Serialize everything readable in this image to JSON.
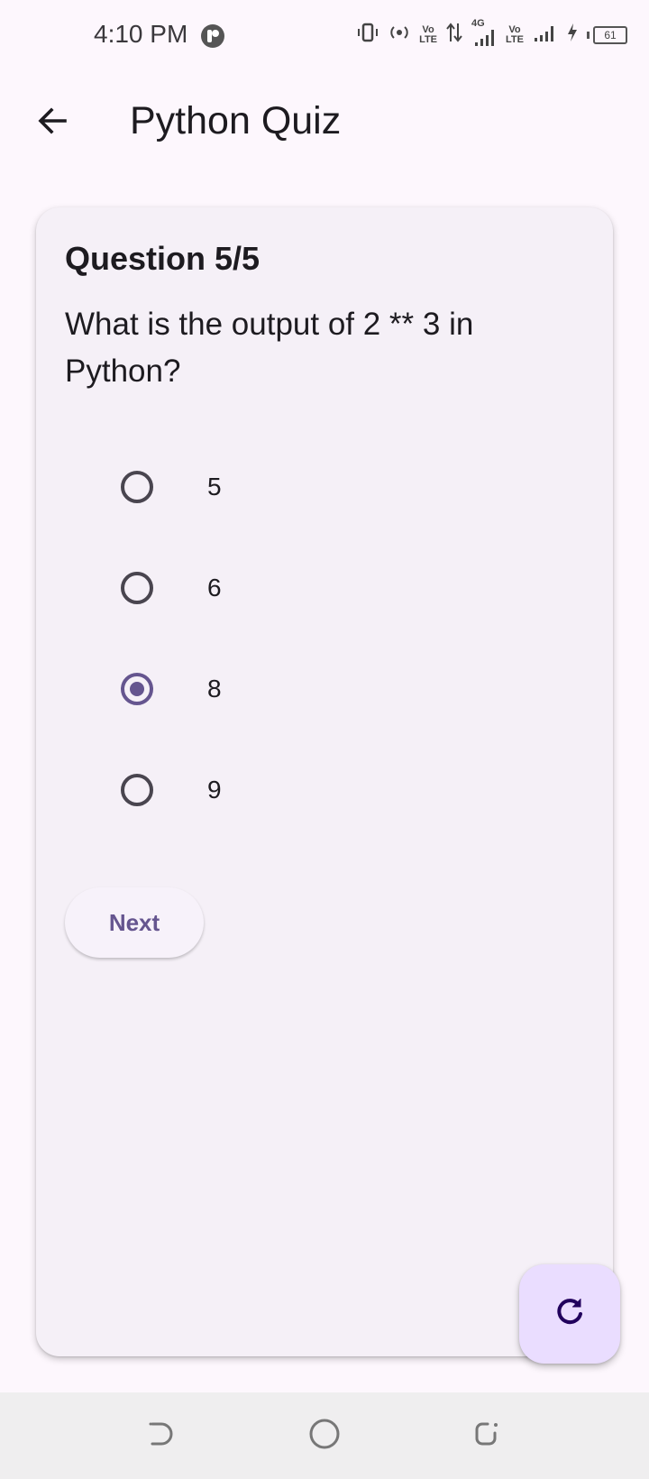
{
  "status_bar": {
    "time": "4:10 PM",
    "volte1": "Vo\nLTE",
    "network": "4G",
    "volte2": "Vo\nLTE",
    "battery": "61",
    "icons": [
      "vibrate-icon",
      "hotspot-icon",
      "volte-icon",
      "data-arrows-icon",
      "signal-4g-icon",
      "volte-icon",
      "signal-icon",
      "charging-icon",
      "battery-icon"
    ]
  },
  "app_bar": {
    "title": "Python Quiz",
    "back_icon": "arrow-back-icon"
  },
  "quiz": {
    "question_number": "Question 5/5",
    "question_text": "What is the output of 2 ** 3 in Python?",
    "options": [
      "5",
      "6",
      "8",
      "9"
    ],
    "selected_option": "8",
    "next_label": "Next"
  },
  "fab": {
    "icon": "refresh-icon"
  },
  "nav_bar": {
    "icons": [
      "back-nav-icon",
      "home-nav-icon",
      "recents-nav-icon"
    ]
  },
  "colors": {
    "primary": "#65558f",
    "background": "#fdf7fd",
    "card": "#f5f0f7",
    "fab": "#eaddff",
    "nav": "#efeeef"
  }
}
